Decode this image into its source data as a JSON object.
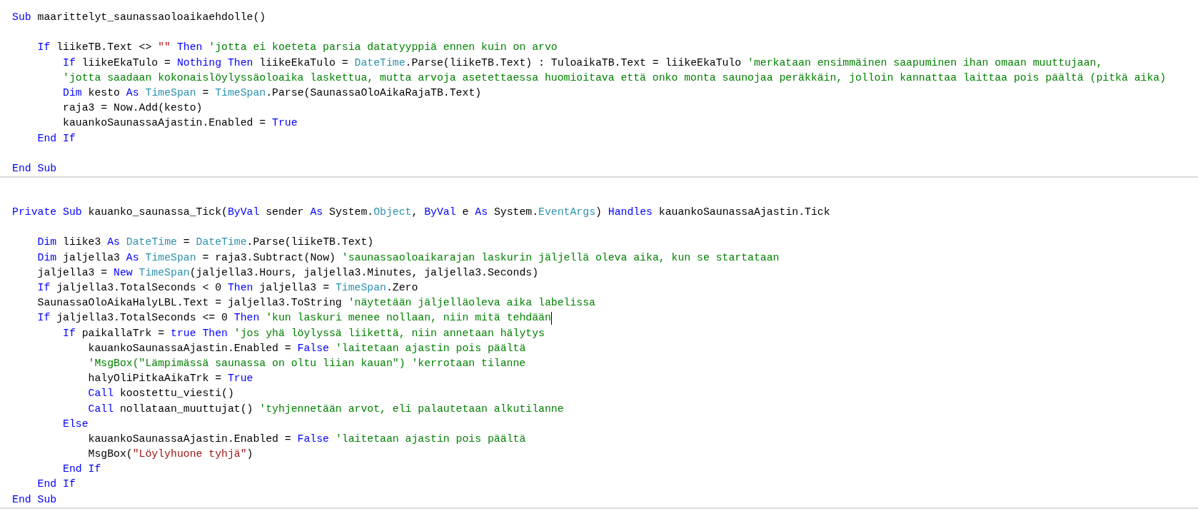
{
  "editor": {
    "blocks": [
      {
        "groups": [
          [
            {
              "tokens": [
                {
                  "kind": "keyword",
                  "text": "Sub"
                },
                {
                  "kind": "plain",
                  "text": " maarittelyt_saunassaoloaikaehdolle()"
                }
              ]
            }
          ],
          [
            {
              "tokens": [
                {
                  "kind": "keyword",
                  "text": "    If"
                },
                {
                  "kind": "plain",
                  "text": " liikeTB.Text <> "
                },
                {
                  "kind": "string",
                  "text": "\"\""
                },
                {
                  "kind": "keyword",
                  "text": " Then"
                },
                {
                  "kind": "comment",
                  "text": " 'jotta ei koeteta parsia datatyyppiä ennen kuin on arvo"
                }
              ]
            },
            {
              "tokens": [
                {
                  "kind": "keyword",
                  "text": "        If"
                },
                {
                  "kind": "plain",
                  "text": " liikeEkaTulo = "
                },
                {
                  "kind": "keyword",
                  "text": "Nothing Then"
                },
                {
                  "kind": "plain",
                  "text": " liikeEkaTulo = "
                },
                {
                  "kind": "type",
                  "text": "DateTime"
                },
                {
                  "kind": "plain",
                  "text": ".Parse(liikeTB.Text) : TuloaikaTB.Text = liikeEkaTulo "
                },
                {
                  "kind": "comment",
                  "text": "'merkataan ensimmäinen saapuminen ihan omaan muuttujaan,"
                }
              ]
            },
            {
              "tokens": [
                {
                  "kind": "comment",
                  "text": "        'jotta saadaan kokonaislöylyssäoloaika laskettua, mutta arvoja asetettaessa huomioitava että onko monta saunojaa peräkkäin, jolloin kannattaa laittaa pois päältä (pitkä aika)"
                }
              ]
            },
            {
              "tokens": [
                {
                  "kind": "keyword",
                  "text": "        Dim"
                },
                {
                  "kind": "plain",
                  "text": " kesto "
                },
                {
                  "kind": "keyword",
                  "text": "As"
                },
                {
                  "kind": "type",
                  "text": " TimeSpan"
                },
                {
                  "kind": "plain",
                  "text": " = "
                },
                {
                  "kind": "type",
                  "text": "TimeSpan"
                },
                {
                  "kind": "plain",
                  "text": ".Parse(SaunassaOloAikaRajaTB.Text)"
                }
              ]
            },
            {
              "tokens": [
                {
                  "kind": "plain",
                  "text": "        raja3 = Now.Add(kesto)"
                }
              ]
            },
            {
              "tokens": [
                {
                  "kind": "plain",
                  "text": "        kauankoSaunassaAjastin.Enabled = "
                },
                {
                  "kind": "keyword",
                  "text": "True"
                }
              ]
            },
            {
              "tokens": [
                {
                  "kind": "keyword",
                  "text": "    End If"
                }
              ]
            }
          ],
          [
            {
              "tokens": [
                {
                  "kind": "keyword",
                  "text": "End Sub"
                }
              ]
            }
          ]
        ]
      },
      {
        "groups": [
          [
            {
              "tokens": [
                {
                  "kind": "keyword",
                  "text": "Private Sub"
                },
                {
                  "kind": "plain",
                  "text": " kauanko_saunassa_Tick("
                },
                {
                  "kind": "keyword",
                  "text": "ByVal"
                },
                {
                  "kind": "plain",
                  "text": " sender "
                },
                {
                  "kind": "keyword",
                  "text": "As"
                },
                {
                  "kind": "plain",
                  "text": " System."
                },
                {
                  "kind": "type",
                  "text": "Object"
                },
                {
                  "kind": "plain",
                  "text": ", "
                },
                {
                  "kind": "keyword",
                  "text": "ByVal"
                },
                {
                  "kind": "plain",
                  "text": " e "
                },
                {
                  "kind": "keyword",
                  "text": "As"
                },
                {
                  "kind": "plain",
                  "text": " System."
                },
                {
                  "kind": "type",
                  "text": "EventArgs"
                },
                {
                  "kind": "plain",
                  "text": ") "
                },
                {
                  "kind": "keyword",
                  "text": "Handles"
                },
                {
                  "kind": "plain",
                  "text": " kauankoSaunassaAjastin.Tick"
                }
              ]
            }
          ],
          [
            {
              "tokens": [
                {
                  "kind": "keyword",
                  "text": "    Dim"
                },
                {
                  "kind": "plain",
                  "text": " liike3 "
                },
                {
                  "kind": "keyword",
                  "text": "As"
                },
                {
                  "kind": "type",
                  "text": " DateTime"
                },
                {
                  "kind": "plain",
                  "text": " = "
                },
                {
                  "kind": "type",
                  "text": "DateTime"
                },
                {
                  "kind": "plain",
                  "text": ".Parse(liikeTB.Text)"
                }
              ]
            },
            {
              "tokens": [
                {
                  "kind": "keyword",
                  "text": "    Dim"
                },
                {
                  "kind": "plain",
                  "text": " jaljella3 "
                },
                {
                  "kind": "keyword",
                  "text": "As"
                },
                {
                  "kind": "type",
                  "text": " TimeSpan"
                },
                {
                  "kind": "plain",
                  "text": " = raja3.Subtract(Now) "
                },
                {
                  "kind": "comment",
                  "text": "'saunassaoloaikarajan laskurin jäljellä oleva aika, kun se startataan"
                }
              ]
            },
            {
              "tokens": [
                {
                  "kind": "plain",
                  "text": "    jaljella3 = "
                },
                {
                  "kind": "keyword",
                  "text": "New"
                },
                {
                  "kind": "type",
                  "text": " TimeSpan"
                },
                {
                  "kind": "plain",
                  "text": "(jaljella3.Hours, jaljella3.Minutes, jaljella3.Seconds)"
                }
              ]
            },
            {
              "tokens": [
                {
                  "kind": "keyword",
                  "text": "    If"
                },
                {
                  "kind": "plain",
                  "text": " jaljella3.TotalSeconds < 0 "
                },
                {
                  "kind": "keyword",
                  "text": "Then"
                },
                {
                  "kind": "plain",
                  "text": " jaljella3 = "
                },
                {
                  "kind": "type",
                  "text": "TimeSpan"
                },
                {
                  "kind": "plain",
                  "text": ".Zero"
                }
              ]
            },
            {
              "tokens": [
                {
                  "kind": "plain",
                  "text": "    SaunassaOloAikaHalyLBL.Text = jaljella3.ToString "
                },
                {
                  "kind": "comment",
                  "text": "'näytetään jäljelläoleva aika labelissa"
                }
              ]
            },
            {
              "caret": true,
              "tokens": [
                {
                  "kind": "keyword",
                  "text": "    If"
                },
                {
                  "kind": "plain",
                  "text": " jaljella3.TotalSeconds <= 0 "
                },
                {
                  "kind": "keyword",
                  "text": "Then"
                },
                {
                  "kind": "comment",
                  "text": " 'kun laskuri menee nollaan, niin mitä tehdään"
                }
              ]
            },
            {
              "tokens": [
                {
                  "kind": "keyword",
                  "text": "        If"
                },
                {
                  "kind": "plain",
                  "text": " paikallaTrk = "
                },
                {
                  "kind": "keyword",
                  "text": "true Then"
                },
                {
                  "kind": "comment",
                  "text": " 'jos yhä löylyssä liikettä, niin annetaan hälytys"
                }
              ]
            },
            {
              "tokens": [
                {
                  "kind": "plain",
                  "text": "            kauankoSaunassaAjastin.Enabled = "
                },
                {
                  "kind": "keyword",
                  "text": "False"
                },
                {
                  "kind": "comment",
                  "text": " 'laitetaan ajastin pois päältä"
                }
              ]
            },
            {
              "tokens": [
                {
                  "kind": "comment",
                  "text": "            'MsgBox(\"Lämpimässä saunassa on oltu liian kauan\") 'kerrotaan tilanne"
                }
              ]
            },
            {
              "tokens": [
                {
                  "kind": "plain",
                  "text": "            halyOliPitkaAikaTrk = "
                },
                {
                  "kind": "keyword",
                  "text": "True"
                }
              ]
            },
            {
              "tokens": [
                {
                  "kind": "keyword",
                  "text": "            Call"
                },
                {
                  "kind": "plain",
                  "text": " koostettu_viesti()"
                }
              ]
            },
            {
              "tokens": [
                {
                  "kind": "keyword",
                  "text": "            Call"
                },
                {
                  "kind": "plain",
                  "text": " nollataan_muuttujat() "
                },
                {
                  "kind": "comment",
                  "text": "'tyhjennetään arvot, eli palautetaan alkutilanne"
                }
              ]
            },
            {
              "tokens": [
                {
                  "kind": "keyword",
                  "text": "        Else"
                }
              ]
            },
            {
              "tokens": [
                {
                  "kind": "plain",
                  "text": "            kauankoSaunassaAjastin.Enabled = "
                },
                {
                  "kind": "keyword",
                  "text": "False"
                },
                {
                  "kind": "comment",
                  "text": " 'laitetaan ajastin pois päältä"
                }
              ]
            },
            {
              "tokens": [
                {
                  "kind": "plain",
                  "text": "            MsgBox("
                },
                {
                  "kind": "string",
                  "text": "\"Löylyhuone tyhjä\""
                },
                {
                  "kind": "plain",
                  "text": ")"
                }
              ]
            },
            {
              "tokens": [
                {
                  "kind": "keyword",
                  "text": "        End If"
                }
              ]
            },
            {
              "tokens": [
                {
                  "kind": "keyword",
                  "text": "    End If"
                }
              ]
            },
            {
              "tokens": [
                {
                  "kind": "keyword",
                  "text": "End Sub"
                }
              ]
            }
          ]
        ]
      }
    ]
  }
}
